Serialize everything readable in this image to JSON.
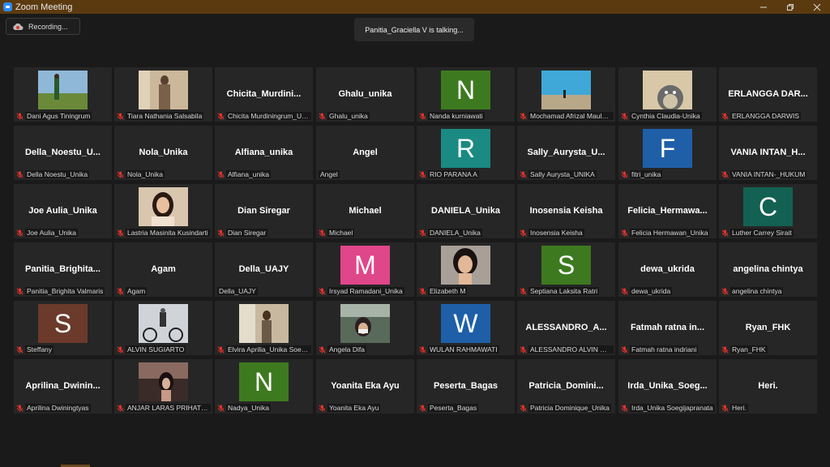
{
  "window": {
    "title": "Zoom Meeting"
  },
  "recording": {
    "label": "Recording..."
  },
  "banner": {
    "talking": "Panitia_Graciella V is talking..."
  },
  "participants": [
    {
      "label": "Dani Agus Tiningrum",
      "type": "photo",
      "photo": "field",
      "muted": true
    },
    {
      "label": "Tiara Nathania Salsabila",
      "type": "photo",
      "photo": "person-beige",
      "muted": true
    },
    {
      "label": "Chicita Murdiningrum_Unika",
      "type": "name",
      "big": "Chicita_Murdini...",
      "muted": true
    },
    {
      "label": "Ghalu_unika",
      "type": "name",
      "big": "Ghalu_unika",
      "muted": true
    },
    {
      "label": "Nanda kurniawati",
      "type": "letter",
      "letter": "N",
      "color": "#3d7a1f",
      "muted": true
    },
    {
      "label": "Mochamad Afrizal Maulana",
      "type": "photo",
      "photo": "sea",
      "muted": true
    },
    {
      "label": "Cynthia Claudia-Unika",
      "type": "photo",
      "photo": "totoro",
      "muted": true
    },
    {
      "label": "ERLANGGA DARWIS",
      "type": "name",
      "big": "ERLANGGA DAR...",
      "muted": true
    },
    {
      "label": "Della Noestu_Unika",
      "type": "name",
      "big": "Della_Noestu_U...",
      "muted": true
    },
    {
      "label": "Nola_Unika",
      "type": "name",
      "big": "Nola_Unika",
      "muted": true
    },
    {
      "label": "Alfiana_unika",
      "type": "name",
      "big": "Alfiana_unika",
      "muted": true
    },
    {
      "label": "Angel",
      "type": "name",
      "big": "Angel",
      "muted": false
    },
    {
      "label": "RIO PARANA A",
      "type": "letter",
      "letter": "R",
      "color": "#1a8a82",
      "muted": true
    },
    {
      "label": "Sally Aurysta_UNIKA",
      "type": "name",
      "big": "Sally_Aurysta_U...",
      "muted": true
    },
    {
      "label": "fitri_unika",
      "type": "letter",
      "letter": "F",
      "color": "#1f5fa8",
      "muted": true
    },
    {
      "label": "VANIA INTAN-_HUKUM",
      "type": "name",
      "big": "VANIA INTAN_H...",
      "muted": true
    },
    {
      "label": "Joe Aulia_Unika",
      "type": "name",
      "big": "Joe Aulia_Unika",
      "muted": true
    },
    {
      "label": "Lastria Masinita Kusindarti",
      "type": "photo",
      "photo": "girl",
      "muted": true
    },
    {
      "label": "Dian Siregar",
      "type": "name",
      "big": "Dian Siregar",
      "muted": true
    },
    {
      "label": "Michael",
      "type": "name",
      "big": "Michael",
      "muted": true
    },
    {
      "label": "DANIELA_Unika",
      "type": "name",
      "big": "DANIELA_Unika",
      "muted": true
    },
    {
      "label": "Inosensia Keisha",
      "type": "name",
      "big": "Inosensia Keisha",
      "muted": true
    },
    {
      "label": "Felicia Hermawan_Unika",
      "type": "name",
      "big": "Felicia_Hermawa...",
      "muted": true
    },
    {
      "label": "Luther Carrey Sirait",
      "type": "letter",
      "letter": "C",
      "color": "#136152",
      "muted": true
    },
    {
      "label": "Panitia_Brighita Valmaris",
      "type": "name",
      "big": "Panitia_Brighita...",
      "muted": true
    },
    {
      "label": "Agam",
      "type": "name",
      "big": "Agam",
      "muted": true
    },
    {
      "label": "Della_UAJY",
      "type": "name",
      "big": "Della_UAJY",
      "muted": false
    },
    {
      "label": "Irsyad Ramadani_Unika",
      "type": "letter",
      "letter": "M",
      "color": "#e0468a",
      "muted": true
    },
    {
      "label": "Elizabeth M",
      "type": "photo",
      "photo": "crying",
      "muted": true
    },
    {
      "label": "Septiana Laksita Ratri",
      "type": "letter",
      "letter": "S",
      "color": "#3d7a1f",
      "muted": true
    },
    {
      "label": "dewa_ukrida",
      "type": "name",
      "big": "dewa_ukrida",
      "muted": true
    },
    {
      "label": "angelina chintya",
      "type": "name",
      "big": "angelina chintya",
      "muted": true
    },
    {
      "label": "Steffany",
      "type": "letter",
      "letter": "S",
      "color": "#6b3a2a",
      "muted": true
    },
    {
      "label": "ALVIN SUGIARTO",
      "type": "photo",
      "photo": "cyclist",
      "muted": true
    },
    {
      "label": "Elvira Aprilia_Unika Soegijapranata",
      "type": "photo",
      "photo": "girl2",
      "muted": true
    },
    {
      "label": "Angela Difa",
      "type": "photo",
      "photo": "mask",
      "muted": true
    },
    {
      "label": "WULAN RAHMAWATI",
      "type": "letter",
      "letter": "W",
      "color": "#1f5fa8",
      "muted": true
    },
    {
      "label": "ALESSANDRO ALVIN WIJAYA",
      "type": "name",
      "big": "ALESSANDRO_A...",
      "muted": true
    },
    {
      "label": "Fatmah ratna indriani",
      "type": "name",
      "big": "Fatmah ratna in...",
      "muted": true
    },
    {
      "label": "Ryan_FHK",
      "type": "name",
      "big": "Ryan_FHK",
      "muted": true
    },
    {
      "label": "Aprilina Dwiningtyas",
      "type": "name",
      "big": "Aprilina_Dwinin...",
      "muted": true
    },
    {
      "label": "ANJAR LARAS PRIHATINI",
      "type": "photo",
      "photo": "selfie",
      "muted": true
    },
    {
      "label": "Nadya_Unika",
      "type": "letter",
      "letter": "N",
      "color": "#3d7a1f",
      "muted": true
    },
    {
      "label": "Yoanita Eka Ayu",
      "type": "name",
      "big": "Yoanita Eka Ayu",
      "muted": true
    },
    {
      "label": "Peserta_Bagas",
      "type": "name",
      "big": "Peserta_Bagas",
      "muted": true
    },
    {
      "label": "Patricia Dominique_Unika",
      "type": "name",
      "big": "Patricia_Domini...",
      "muted": true
    },
    {
      "label": "Irda_Unika Soegijapranata",
      "type": "name",
      "big": "Irda_Unika_Soeg...",
      "muted": true
    },
    {
      "label": "Heri.",
      "type": "name",
      "big": "Heri.",
      "muted": true
    }
  ],
  "colors": {
    "titlebar": "#5c3a10",
    "background": "#1a1a1a",
    "tile": "#262626",
    "mute_red": "#e5322d"
  }
}
